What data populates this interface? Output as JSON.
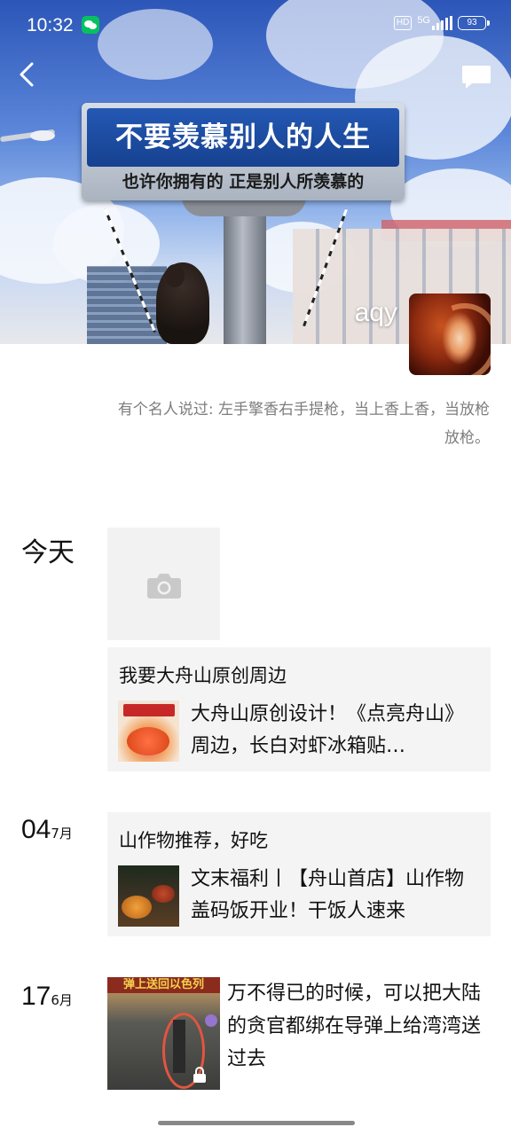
{
  "status_bar": {
    "time": "10:32",
    "hd": "HD",
    "network": "5G",
    "battery": "93"
  },
  "cover": {
    "sign_title": "不要羡慕别人的人生",
    "sign_subtitle": "也许你拥有的 正是别人所羡慕的"
  },
  "profile": {
    "name": "aqy",
    "signature": "有个名人说过: 左手擎香右手提枪，当上香上香，当放枪放枪。"
  },
  "feed": [
    {
      "date": "今天",
      "type": "add-photo"
    },
    {
      "type": "shared-article",
      "caption": "我要大舟山原创周边",
      "article_title": "大舟山原创设计！《点亮舟山》周边，长白对虾冰箱贴…"
    },
    {
      "date_day": "04",
      "date_month": "7月",
      "type": "shared-article",
      "caption": "山作物推荐，好吃",
      "article_title": "文末福利丨【舟山首店】山作物盖码饭开业！干饭人速来"
    },
    {
      "date_day": "17",
      "date_month": "6月",
      "type": "video",
      "text": "万不得已的时候，可以把大陆的贪官都绑在导弹上给湾湾送过去",
      "thumb_banner": "弹上送回以色列"
    }
  ],
  "icons": {
    "back": "chevron-left-icon",
    "comment": "message-icon",
    "camera": "camera-icon",
    "lock": "lock-icon"
  },
  "colors": {
    "wechat_green": "#07c160",
    "card_bg": "#f4f4f4",
    "signature_gray": "#7d7d7d"
  }
}
